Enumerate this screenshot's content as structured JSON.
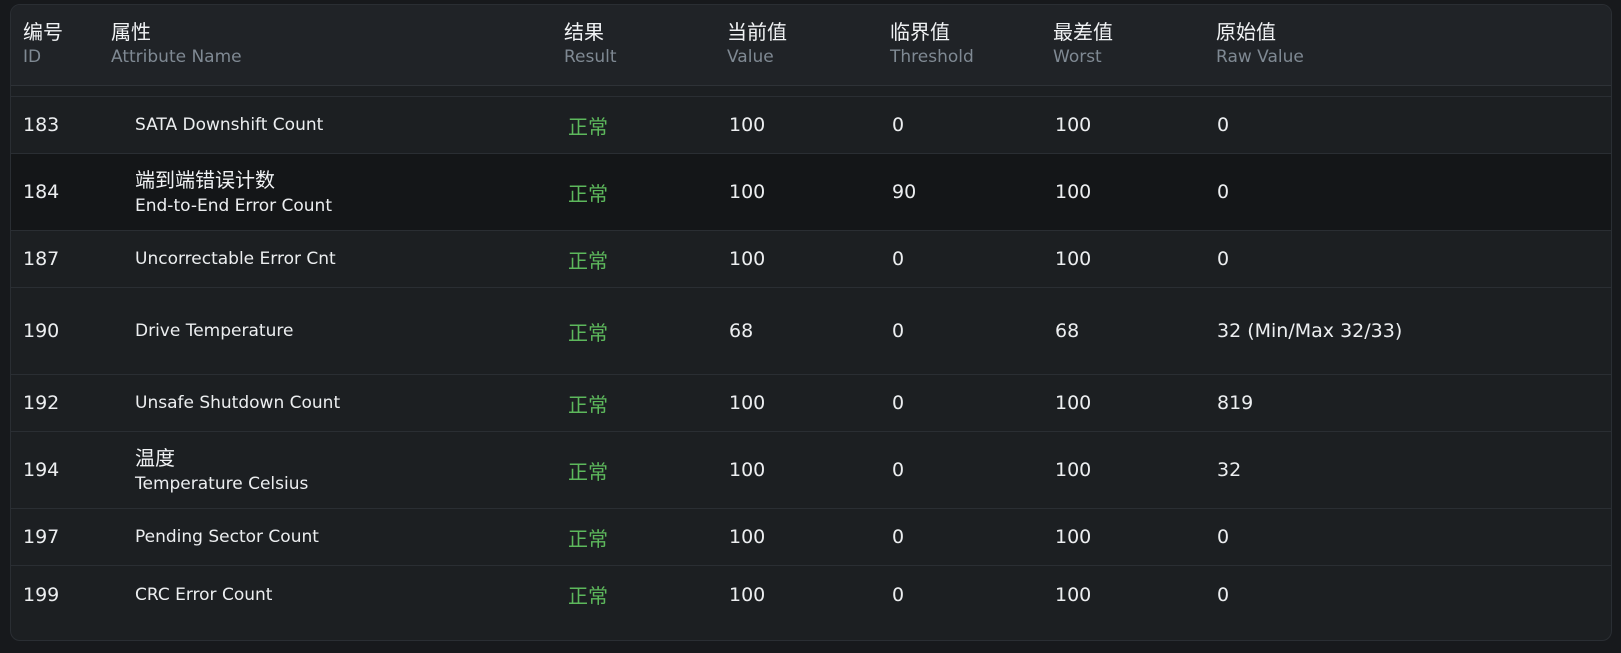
{
  "columns": [
    {
      "zh": "编号",
      "en": "ID"
    },
    {
      "zh": "属性",
      "en": "Attribute Name"
    },
    {
      "zh": "结果",
      "en": "Result"
    },
    {
      "zh": "当前值",
      "en": "Value"
    },
    {
      "zh": "临界值",
      "en": "Threshold"
    },
    {
      "zh": "最差值",
      "en": "Worst"
    },
    {
      "zh": "原始值",
      "en": "Raw Value"
    }
  ],
  "rows": [
    {
      "id": "183",
      "name_zh": "",
      "name_en": "SATA Downshift Count",
      "result": "正常",
      "value": "100",
      "threshold": "0",
      "worst": "100",
      "raw": "0"
    },
    {
      "id": "184",
      "name_zh": "端到端错误计数",
      "name_en": "End-to-End Error Count",
      "result": "正常",
      "value": "100",
      "threshold": "90",
      "worst": "100",
      "raw": "0"
    },
    {
      "id": "187",
      "name_zh": "",
      "name_en": "Uncorrectable Error Cnt",
      "result": "正常",
      "value": "100",
      "threshold": "0",
      "worst": "100",
      "raw": "0"
    },
    {
      "id": "190",
      "name_zh": "",
      "name_en": "Drive Temperature",
      "result": "正常",
      "value": "68",
      "threshold": "0",
      "worst": "68",
      "raw": "32 (Min/Max 32/33)"
    },
    {
      "id": "192",
      "name_zh": "",
      "name_en": "Unsafe Shutdown Count",
      "result": "正常",
      "value": "100",
      "threshold": "0",
      "worst": "100",
      "raw": "819"
    },
    {
      "id": "194",
      "name_zh": "温度",
      "name_en": "Temperature Celsius",
      "result": "正常",
      "value": "100",
      "threshold": "0",
      "worst": "100",
      "raw": "32"
    },
    {
      "id": "197",
      "name_zh": "",
      "name_en": "Pending Sector Count",
      "result": "正常",
      "value": "100",
      "threshold": "0",
      "worst": "100",
      "raw": "0"
    },
    {
      "id": "199",
      "name_zh": "",
      "name_en": "CRC Error Count",
      "result": "正常",
      "value": "100",
      "threshold": "0",
      "worst": "100",
      "raw": "0"
    }
  ]
}
